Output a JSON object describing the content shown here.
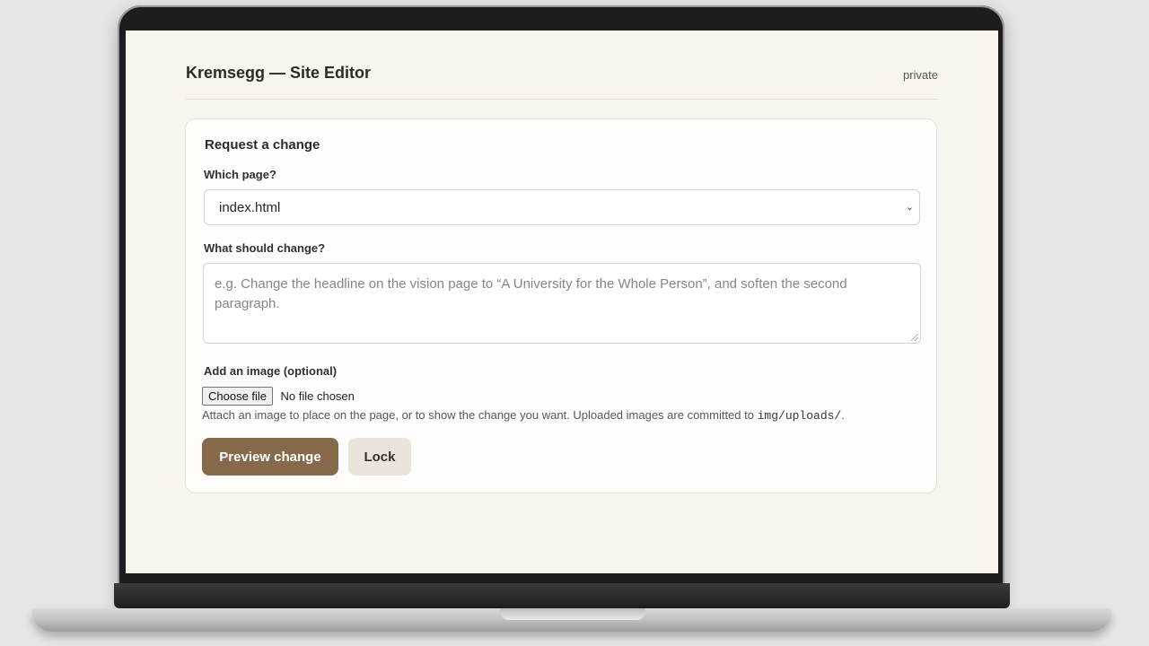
{
  "header": {
    "title": "Kremsegg — Site Editor",
    "visibility": "private"
  },
  "form": {
    "title": "Request a change",
    "page_label": "Which page?",
    "page_value": "index.html",
    "change_label": "What should change?",
    "change_placeholder": "e.g. Change the headline on the vision page to “A University for the Whole Person”, and soften the second paragraph.",
    "image_label": "Add an image (optional)",
    "choose_file_label": "Choose file",
    "no_file_text": "No file chosen",
    "hint_text": "Attach an image to place on the page, or to show the change you want. Uploaded images are committed to ",
    "hint_path": "img/uploads/",
    "hint_end": ".",
    "preview_button": "Preview change",
    "lock_button": "Lock"
  },
  "colors": {
    "accent": "#86694a",
    "page_bg": "#f8f4ee",
    "secondary_button": "#ebe4da"
  },
  "icons": {
    "select": "chevron-down-icon",
    "textarea": "resize-handle-icon"
  }
}
